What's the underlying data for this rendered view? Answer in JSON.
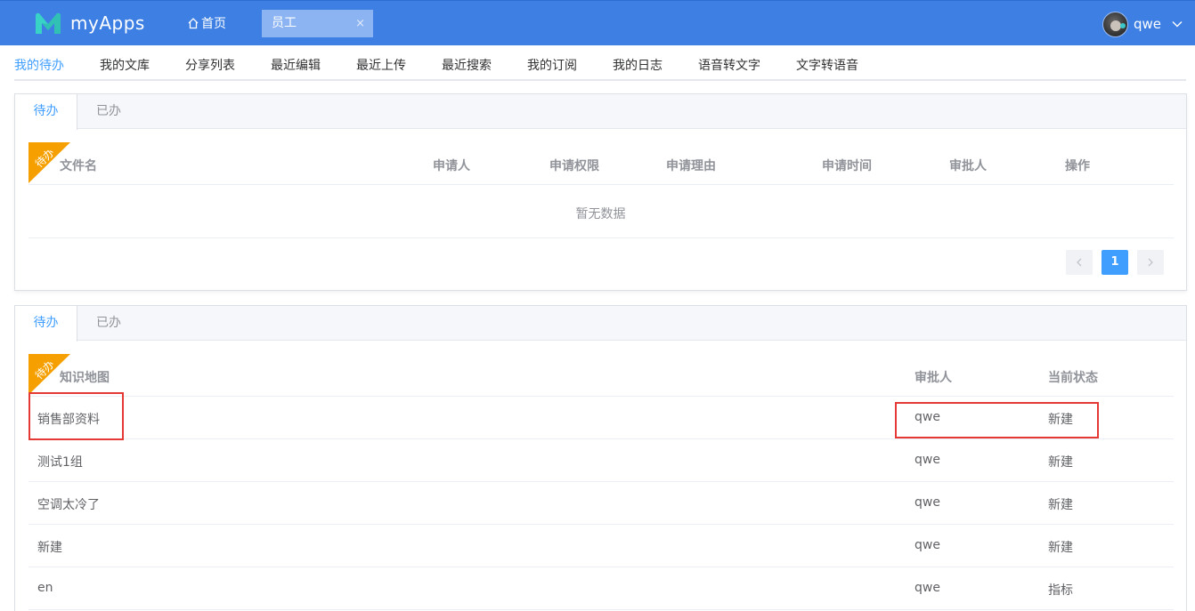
{
  "header": {
    "app_name": "myApps",
    "home_label": "首页",
    "open_tab": "员工",
    "close_glyph": "×",
    "username": "qwe",
    "brand_color": "#3d7fe3"
  },
  "nav": {
    "items": [
      "我的待办",
      "我的文库",
      "分享列表",
      "最近编辑",
      "最近上传",
      "最近搜索",
      "我的订阅",
      "我的日志",
      "语音转文字",
      "文字转语音"
    ],
    "active_index": 0
  },
  "card1": {
    "tabs": [
      "待办",
      "已办"
    ],
    "ribbon": "待办",
    "columns": [
      "文件名",
      "申请人",
      "申请权限",
      "申请理由",
      "申请时间",
      "审批人",
      "操作"
    ],
    "empty_text": "暂无数据",
    "pagination": {
      "current_page": "1"
    }
  },
  "card2": {
    "tabs": [
      "待办",
      "已办"
    ],
    "ribbon": "待办",
    "columns": [
      "知识地图",
      "审批人",
      "当前状态"
    ],
    "rows": [
      {
        "name": "销售部资料",
        "approver": "qwe",
        "status": "新建"
      },
      {
        "name": "测试1组",
        "approver": "qwe",
        "status": "新建"
      },
      {
        "name": "空调太冷了",
        "approver": "qwe",
        "status": "新建"
      },
      {
        "name": "新建",
        "approver": "qwe",
        "status": "新建"
      },
      {
        "name": "en",
        "approver": "qwe",
        "status": "指标"
      }
    ]
  },
  "colors": {
    "accent": "#409eff",
    "ribbon": "#f5a000",
    "highlight": "#e53935"
  }
}
